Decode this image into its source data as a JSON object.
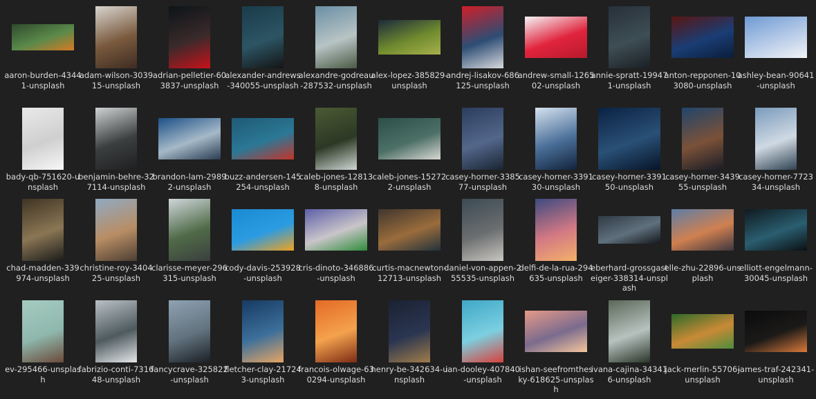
{
  "files": [
    {
      "name": "aaron-burden-43441-unsplash",
      "colors": [
        "#2f4a2d",
        "#5b8a4a",
        "#d77a23"
      ]
    },
    {
      "name": "adam-wilson-303915-unsplash",
      "colors": [
        "#d8d5cf",
        "#7a5a3e",
        "#3e2c22"
      ]
    },
    {
      "name": "adrian-pelletier-603837-unsplash",
      "colors": [
        "#0c1418",
        "#3b2a2b",
        "#c8121b"
      ]
    },
    {
      "name": "alexander-andrews-340055-unsplash",
      "colors": [
        "#1a3b4a",
        "#2c5564",
        "#141414"
      ]
    },
    {
      "name": "alexandre-godreau-287532-unsplash",
      "colors": [
        "#6a8fa5",
        "#b7c4c4",
        "#4c5a45"
      ]
    },
    {
      "name": "alex-lopez-385829-unsplash",
      "colors": [
        "#1b2a3c",
        "#6f8a2e",
        "#a7b04b"
      ]
    },
    {
      "name": "andrej-lisakov-686125-unsplash",
      "colors": [
        "#d01f28",
        "#2d4d74",
        "#d9d9dd"
      ]
    },
    {
      "name": "andrew-small-126502-unsplash",
      "colors": [
        "#f4f4f6",
        "#e1243d",
        "#b61a2d"
      ]
    },
    {
      "name": "annie-spratt-199471-unsplash",
      "colors": [
        "#27303a",
        "#3e4e55",
        "#1a1f24"
      ]
    },
    {
      "name": "anton-repponen-103080-unsplash",
      "colors": [
        "#5a1512",
        "#1a3d75",
        "#0a1d3a"
      ]
    },
    {
      "name": "ashley-bean-90641-unsplash",
      "colors": [
        "#6e9ad3",
        "#b7cbe8",
        "#f2f3f6"
      ]
    },
    {
      "name": "bady-qb-751620-unsplash",
      "colors": [
        "#e9e9e9",
        "#cfcfcf",
        "#f7f7f7"
      ]
    },
    {
      "name": "benjamin-behre-327114-unsplash",
      "colors": [
        "#cfd2d2",
        "#3c3f40",
        "#1e1f20"
      ]
    },
    {
      "name": "brandon-lam-29892-unsplash",
      "colors": [
        "#1c4f86",
        "#a5b9c8",
        "#2b3d52"
      ]
    },
    {
      "name": "buzz-andersen-145254-unsplash",
      "colors": [
        "#1f5a75",
        "#2b7896",
        "#c4342a"
      ]
    },
    {
      "name": "caleb-jones-128138-unsplash",
      "colors": [
        "#4b5a34",
        "#2c3824",
        "#cfd7d4"
      ]
    },
    {
      "name": "caleb-jones-152722-unsplash",
      "colors": [
        "#2c4f49",
        "#4c6f66",
        "#d8d8d3"
      ]
    },
    {
      "name": "casey-horner-338577-unsplash",
      "colors": [
        "#2b3d5d",
        "#53678b",
        "#1a2432"
      ]
    },
    {
      "name": "casey-horner-339130-unsplash",
      "colors": [
        "#d6e2ef",
        "#4a6f98",
        "#12233d"
      ]
    },
    {
      "name": "casey-horner-339150-unsplash",
      "colors": [
        "#0a2242",
        "#2a5076",
        "#061428"
      ]
    },
    {
      "name": "casey-horner-343955-unsplash",
      "colors": [
        "#21456b",
        "#7b5138",
        "#191c27"
      ]
    },
    {
      "name": "casey-horner-772334-unsplash",
      "colors": [
        "#7a9bbc",
        "#cfd9e3",
        "#2f4251"
      ]
    },
    {
      "name": "chad-madden-339974-unsplash",
      "colors": [
        "#3f3424",
        "#8a7654",
        "#1b1c1a"
      ]
    },
    {
      "name": "christine-roy-340425-unsplash",
      "colors": [
        "#90aac3",
        "#b88d64",
        "#4c3e33"
      ]
    },
    {
      "name": "clarisse-meyer-296315-unsplash",
      "colors": [
        "#cfd6da",
        "#506b48",
        "#3a3f3e"
      ]
    },
    {
      "name": "cody-davis-253928-unsplash",
      "colors": [
        "#1a8ad2",
        "#2b9be2",
        "#f0a21f"
      ]
    },
    {
      "name": "cris-dinoto-346886-unsplash",
      "colors": [
        "#5e5fa9",
        "#c9c5c9",
        "#2f8c3b"
      ]
    },
    {
      "name": "curtis-macnewton-12713-unsplash",
      "colors": [
        "#40362d",
        "#9a6c3c",
        "#24323c"
      ]
    },
    {
      "name": "daniel-von-appen-255535-unsplash",
      "colors": [
        "#3c4a55",
        "#6b6e6f",
        "#c9c6c1"
      ]
    },
    {
      "name": "delfi-de-la-rua-294635-unsplash",
      "colors": [
        "#3d4a80",
        "#d27884",
        "#f4b06a"
      ]
    },
    {
      "name": "eberhard-grossgasteiger-338314-unsplash",
      "colors": [
        "#2f3a44",
        "#5f707d",
        "#14181d"
      ]
    },
    {
      "name": "elle-zhu-22896-unsplash",
      "colors": [
        "#5d7ea6",
        "#d08050",
        "#3e3740"
      ]
    },
    {
      "name": "elliott-engelmann-30045-unsplash",
      "colors": [
        "#0f1a20",
        "#2a5e70",
        "#0b0f12"
      ]
    },
    {
      "name": "ev-295466-unsplash",
      "colors": [
        "#a6cbc1",
        "#8fb8ad",
        "#6b4a3a"
      ]
    },
    {
      "name": "fabrizio-conti-731648-unsplash",
      "colors": [
        "#b9c1c6",
        "#4e5a5e",
        "#e5e8ea"
      ]
    },
    {
      "name": "fancycrave-325822-unsplash",
      "colors": [
        "#8fa2b2",
        "#62727e",
        "#1b2025"
      ]
    },
    {
      "name": "fletcher-clay-217243-unsplash",
      "colors": [
        "#173a62",
        "#3c6f9a",
        "#e6a564"
      ]
    },
    {
      "name": "francois-olwage-630294-unsplash",
      "colors": [
        "#e46a25",
        "#f4a24d",
        "#7b2c15"
      ]
    },
    {
      "name": "henry-be-342634-unsplash",
      "colors": [
        "#1b2233",
        "#2a3550",
        "#a07c4a"
      ]
    },
    {
      "name": "ian-dooley-407840-unsplash",
      "colors": [
        "#3fa8c7",
        "#7ccfe0",
        "#d8423c"
      ]
    },
    {
      "name": "ishan-seefromthesky-618625-unsplash",
      "colors": [
        "#e59a87",
        "#7b6b8e",
        "#f5c69b"
      ]
    },
    {
      "name": "ivana-cajina-343416-unsplash",
      "colors": [
        "#5b6857",
        "#b7c2c0",
        "#2b3529"
      ]
    },
    {
      "name": "jack-merlin-55706-unsplash",
      "colors": [
        "#2e6a2a",
        "#c98a36",
        "#4e8d3c"
      ]
    },
    {
      "name": "james-traf-242341-unsplash",
      "colors": [
        "#0b0b0d",
        "#1c1a18",
        "#d97a3a"
      ]
    }
  ]
}
